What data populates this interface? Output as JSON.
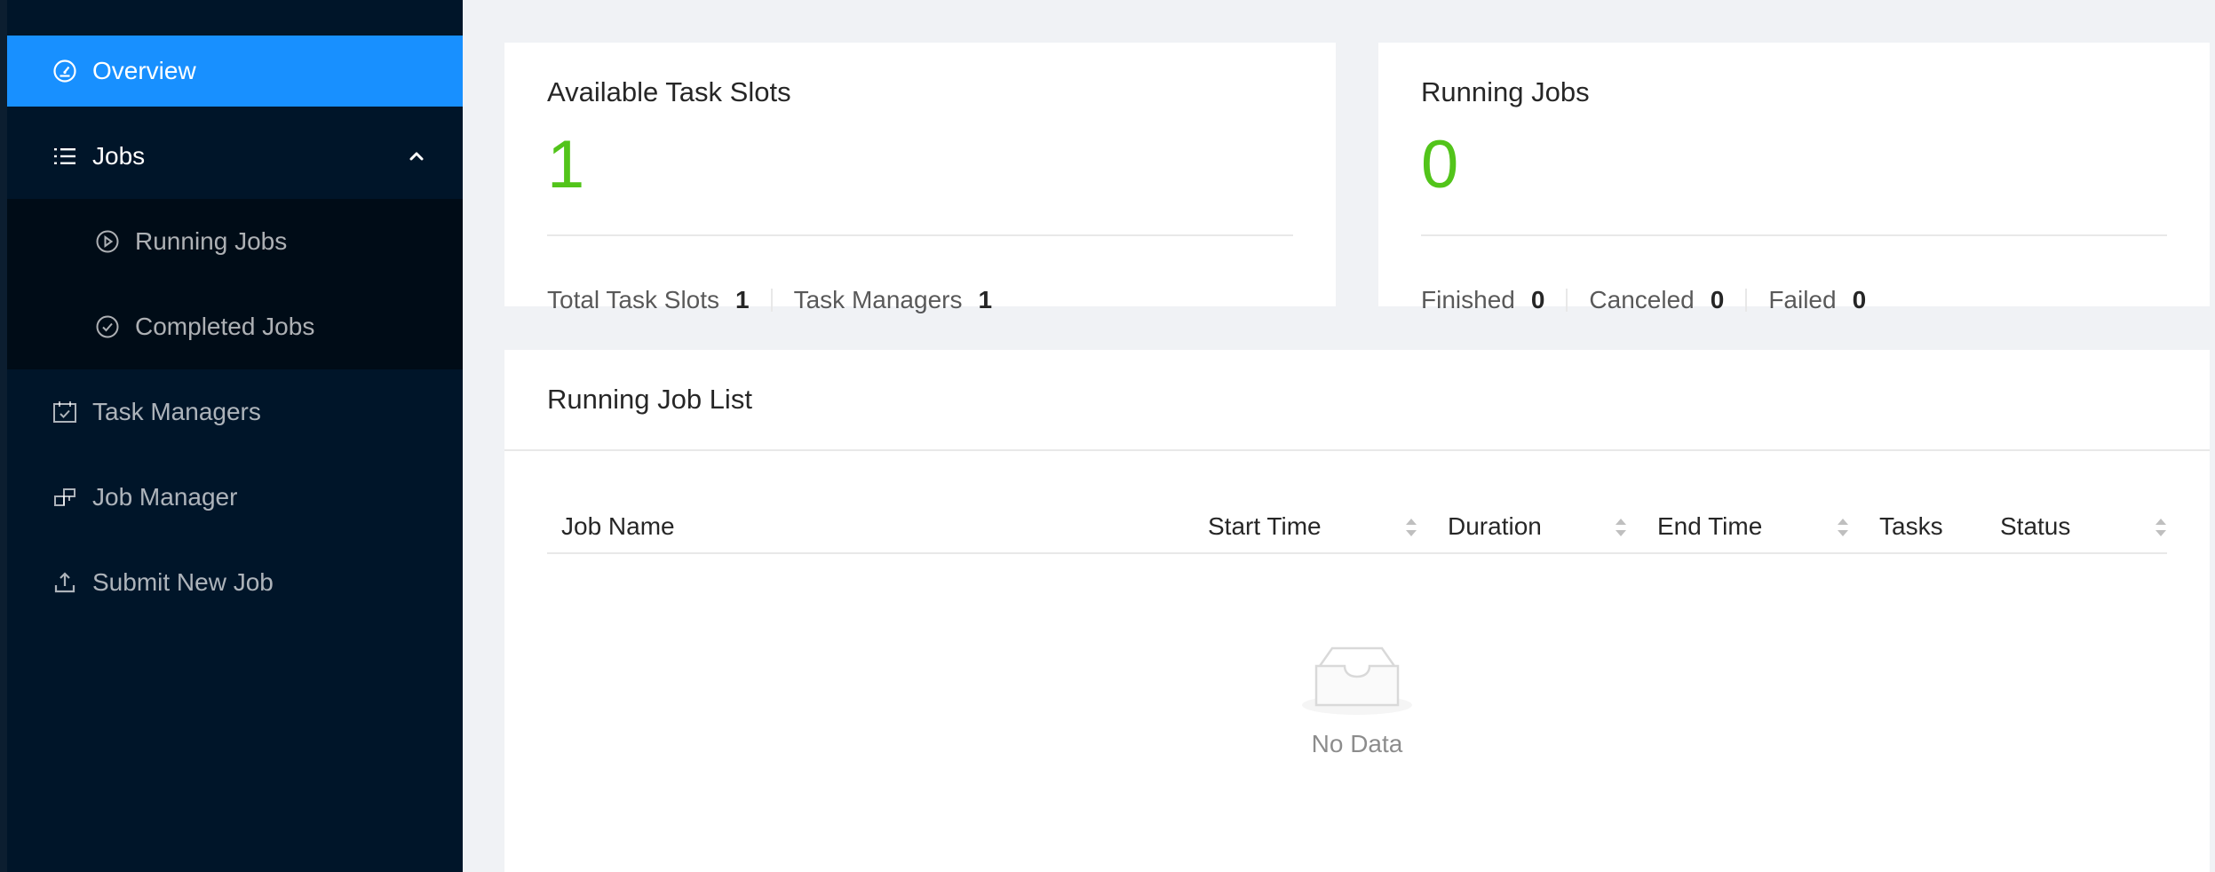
{
  "sidebar": {
    "items": [
      {
        "label": "Overview",
        "icon": "dashboard-icon",
        "selected": true
      },
      {
        "label": "Jobs",
        "icon": "list-icon",
        "expanded": true,
        "children": [
          {
            "label": "Running Jobs",
            "icon": "play-circle-icon"
          },
          {
            "label": "Completed Jobs",
            "icon": "check-circle-icon"
          }
        ]
      },
      {
        "label": "Task Managers",
        "icon": "schedule-icon"
      },
      {
        "label": "Job Manager",
        "icon": "build-icon"
      },
      {
        "label": "Submit New Job",
        "icon": "upload-icon"
      }
    ]
  },
  "slots_card": {
    "title": "Available Task Slots",
    "value": "1",
    "total_label": "Total Task Slots",
    "total_value": "1",
    "tm_label": "Task Managers",
    "tm_value": "1"
  },
  "jobs_card": {
    "title": "Running Jobs",
    "value": "0",
    "finished_label": "Finished",
    "finished_value": "0",
    "canceled_label": "Canceled",
    "canceled_value": "0",
    "failed_label": "Failed",
    "failed_value": "0"
  },
  "job_list": {
    "title": "Running Job List",
    "columns": [
      "Job Name",
      "Start Time",
      "Duration",
      "End Time",
      "Tasks",
      "Status"
    ],
    "rows": [],
    "empty_text": "No Data"
  },
  "colors": {
    "sidebar_bg": "#001529",
    "selected": "#1890ff",
    "stat_green": "#52c41a"
  }
}
